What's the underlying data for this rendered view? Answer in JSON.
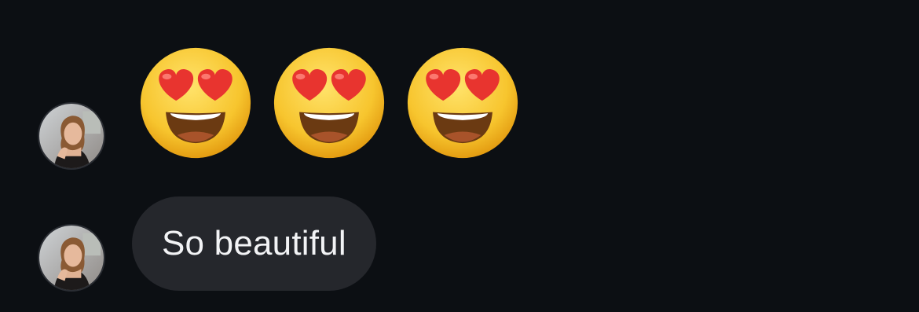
{
  "messages": [
    {
      "type": "emoji",
      "emoji_name": "smiling-face-with-heart-eyes",
      "count": 3,
      "sender_avatar": "avatar-photo"
    },
    {
      "type": "text",
      "text": "So beautiful",
      "sender_avatar": "avatar-photo"
    }
  ],
  "colors": {
    "background": "#0c0f13",
    "bubble": "#25272c",
    "bubble_text": "#f2f3f5"
  }
}
